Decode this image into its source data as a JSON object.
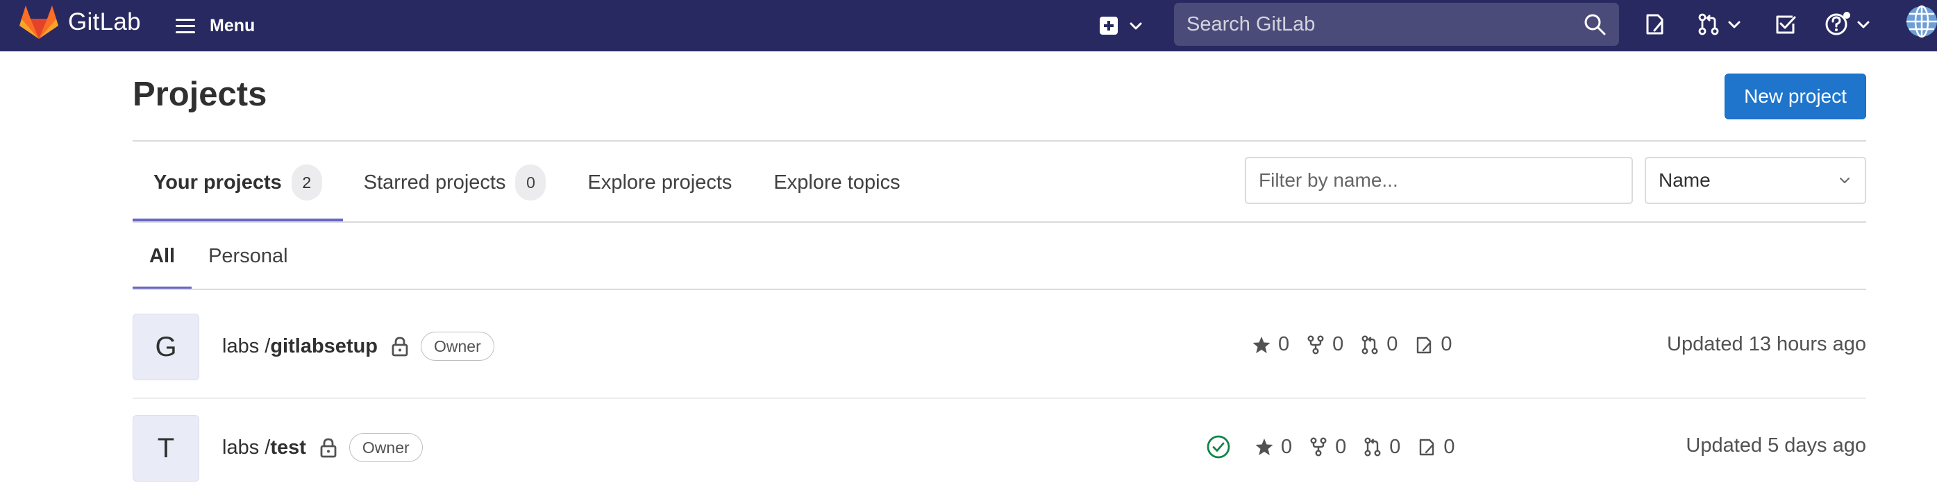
{
  "colors": {
    "nav_bg": "#292961",
    "primary": "#1f75cb",
    "tab_underline": "#6666c4",
    "pipeline_success": "#108548"
  },
  "navbar": {
    "brand": "GitLab",
    "menu_label": "Menu",
    "search_placeholder": "Search GitLab",
    "icons": [
      "plus-square-icon",
      "search-icon",
      "issues-icon",
      "merge-request-icon",
      "todo-icon",
      "help-icon",
      "user-avatar"
    ]
  },
  "page": {
    "title": "Projects",
    "new_project_label": "New project"
  },
  "tabs": [
    {
      "label": "Your projects",
      "count": "2",
      "active": true
    },
    {
      "label": "Starred projects",
      "count": "0",
      "active": false
    },
    {
      "label": "Explore projects",
      "active": false
    },
    {
      "label": "Explore topics",
      "active": false
    }
  ],
  "filter": {
    "placeholder": "Filter by name...",
    "sort_value": "Name"
  },
  "subtabs": [
    {
      "label": "All",
      "active": true
    },
    {
      "label": "Personal",
      "active": false
    }
  ],
  "projects": [
    {
      "avatar_letter": "G",
      "namespace": "labs / ",
      "name": "gitlabsetup",
      "role": "Owner",
      "pipeline_status": "",
      "stars": "0",
      "forks": "0",
      "merge_requests": "0",
      "issues": "0",
      "updated": "Updated 13 hours ago"
    },
    {
      "avatar_letter": "T",
      "namespace": "labs / ",
      "name": "test",
      "role": "Owner",
      "pipeline_status": "passed",
      "stars": "0",
      "forks": "0",
      "merge_requests": "0",
      "issues": "0",
      "updated": "Updated 5 days ago"
    }
  ]
}
